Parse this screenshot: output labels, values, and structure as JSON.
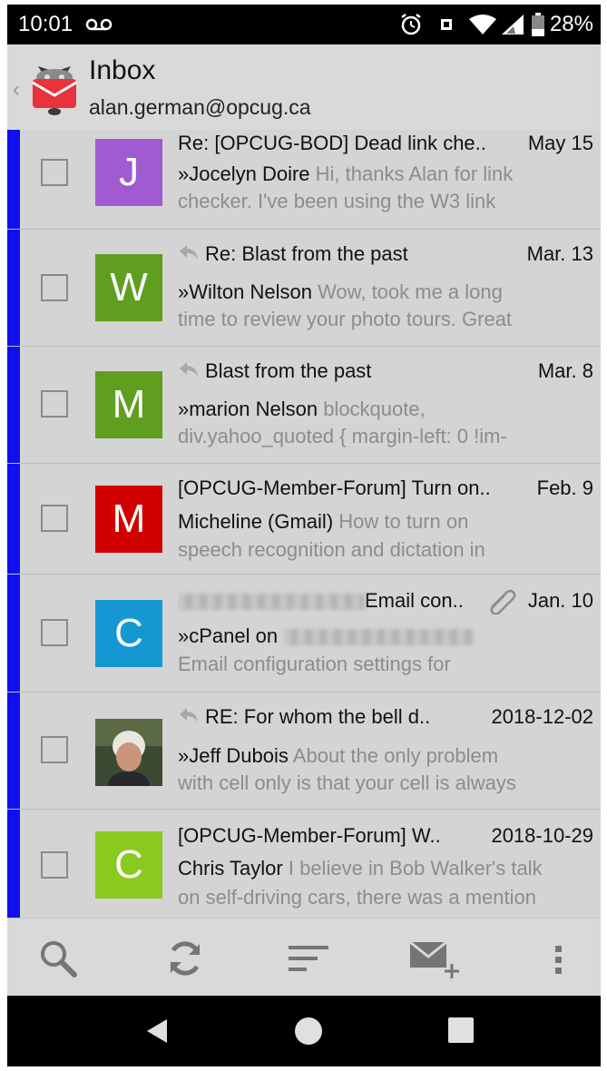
{
  "status_bar": {
    "time": "10:01",
    "voicemail_icon": "voicemail-icon",
    "alarm_icon": "alarm-icon",
    "nfc_icon": "nfc-icon",
    "wifi_icon": "wifi-icon",
    "signal_icon": "signal-icon",
    "battery_icon": "battery-icon",
    "battery_percent": "28%"
  },
  "header": {
    "title": "Inbox",
    "account": "alan.german@opcug.ca",
    "logo_icon": "k9-mail-logo-icon",
    "back_icon": "chevron-left-icon"
  },
  "messages": [
    {
      "subject": "Re: [OPCUG-BOD] Dead link che..",
      "date": "May 15",
      "sender": "»Jocelyn Doire",
      "preview": " Hi, thanks Alan for link",
      "line3": "checker. I've been using the W3 link",
      "avatar_letter": "J",
      "avatar_color": "#a05bd0",
      "replied": false
    },
    {
      "subject": "Re: Blast from the past",
      "date": "Mar. 13",
      "sender": "»Wilton Nelson",
      "preview": " Wow, took me a long",
      "line3": "time to review your photo tours. Great",
      "avatar_letter": "W",
      "avatar_color": "#5f9e1e",
      "replied": true
    },
    {
      "subject": "Blast from the past",
      "date": "Mar. 8",
      "sender": "»marion Nelson",
      "preview": " blockquote,",
      "line3": "div.yahoo_quoted { margin-left: 0 !im-",
      "avatar_letter": "M",
      "avatar_color": "#5f9e1e",
      "replied": true
    },
    {
      "subject": "[OPCUG-Member-Forum] Turn on..",
      "date": "Feb. 9",
      "sender": "Micheline (Gmail)",
      "preview": " How to turn on",
      "line3": "speech recognition and dictation in",
      "avatar_letter": "M",
      "avatar_color": "#d00000",
      "replied": false
    },
    {
      "subject": "Email con..",
      "date": "Jan. 10",
      "sender": "»cPanel on",
      "preview": "",
      "line3": "Email configuration settings for",
      "avatar_letter": "C",
      "avatar_color": "#1597d2",
      "replied": false,
      "has_attachment": true,
      "attachment_icon": "paperclip-icon"
    },
    {
      "subject": "RE: For whom the bell d..",
      "date": "2018-12-02",
      "sender": "»Jeff Dubois",
      "preview": " About the only problem",
      "line3": "with cell only is that your cell is always",
      "avatar_photo": "contact-photo",
      "replied": true
    },
    {
      "subject": "[OPCUG-Member-Forum] W..",
      "date": "2018-10-29",
      "sender": "Chris Taylor",
      "preview": " I believe in Bob Walker's talk",
      "line3": "on self-driving cars, there was a mention",
      "avatar_letter": "C",
      "avatar_color": "#8ac91e",
      "replied": false
    }
  ],
  "toolbar": {
    "search_icon": "search-icon",
    "refresh_icon": "refresh-icon",
    "sort_icon": "sort-icon",
    "compose_icon": "compose-icon",
    "more_icon": "more-vertical-icon"
  },
  "nav_bar": {
    "back_icon": "nav-back-icon",
    "home_icon": "nav-home-icon",
    "recents_icon": "nav-recents-icon"
  },
  "colors": {
    "unread_bar": "#1010ee",
    "list_background": "#d4d4d4",
    "preview_text": "#8c8c8c",
    "logo_red": "#e8323c"
  }
}
